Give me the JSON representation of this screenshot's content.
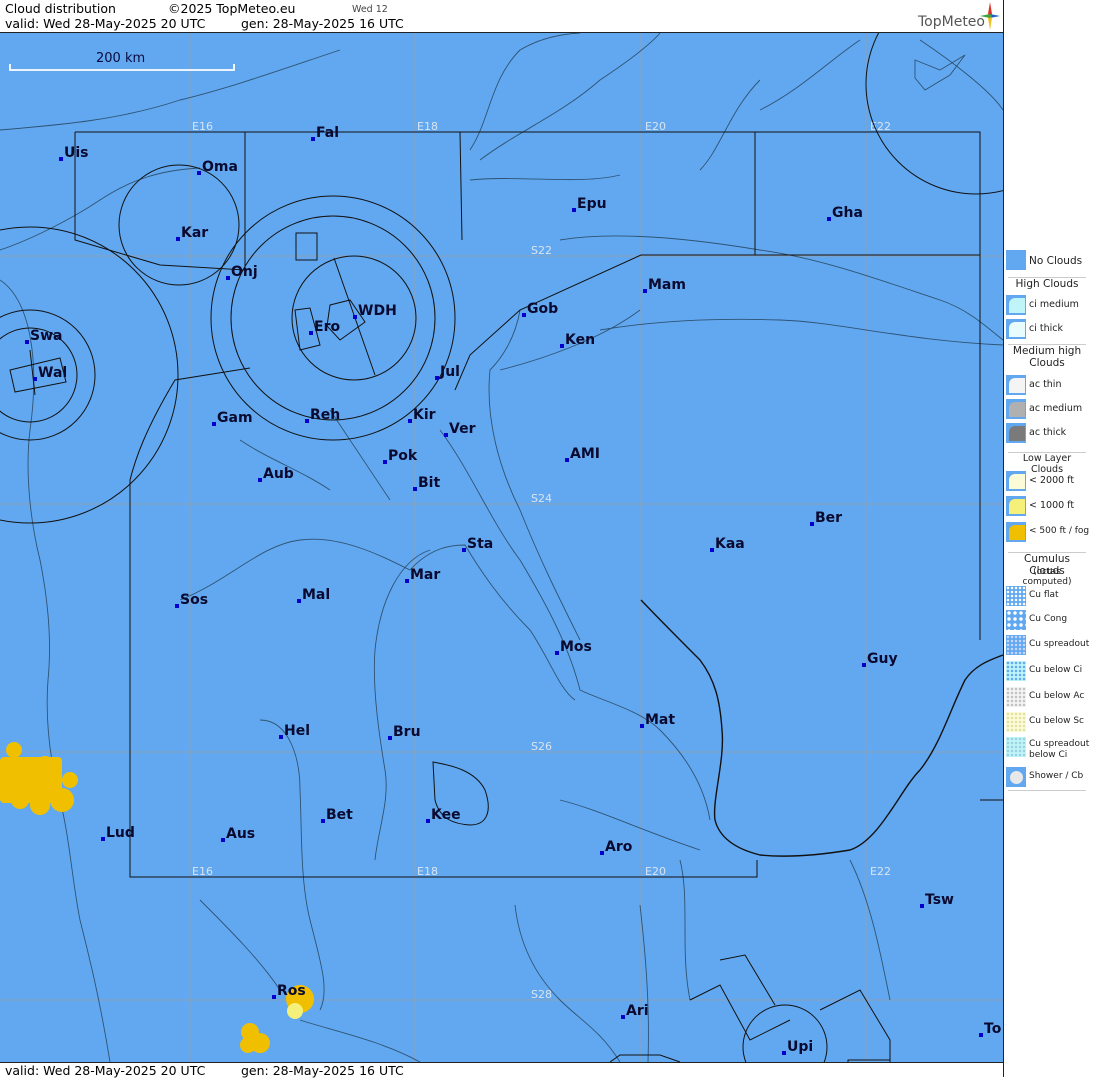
{
  "header": {
    "title": "Cloud distribution",
    "copyright": "©2025 TopMeteo.eu",
    "run_label": "Wed 12",
    "valid": "valid:  Wed  28-May-2025  20 UTC",
    "gen": "gen: 28-May-2025 16 UTC",
    "logo": "TopMeteo"
  },
  "footer": {
    "valid": "valid:  Wed  28-May-2025  20 UTC",
    "gen": "gen: 28-May-2025 16 UTC"
  },
  "scale": {
    "label": "200 km"
  },
  "colors": {
    "no_clouds": "#62a8f0",
    "low_500": "#f0c000",
    "low_1000": "#f4f07a",
    "border": "#000000",
    "river": "#26445e",
    "grid": "#8c9fb4",
    "city_dot": "#0000cc"
  },
  "grid_labels": {
    "lon": [
      "E16",
      "E18",
      "E20",
      "E22"
    ],
    "lat": [
      "S22",
      "S24",
      "S26",
      "S28"
    ]
  },
  "cities": [
    "Uis",
    "Fal",
    "Oma",
    "Kar",
    "Epu",
    "Gha",
    "Onj",
    "Mam",
    "Swa",
    "WDH",
    "Gob",
    "Ero",
    "Ken",
    "Wal",
    "Jul",
    "Gam",
    "Reh",
    "Kir",
    "Ver",
    "Pok",
    "AMI",
    "Aub",
    "Bit",
    "Ber",
    "Sta",
    "Kaa",
    "Mar",
    "Sos",
    "Mal",
    "Mos",
    "Guy",
    "Mat",
    "Hel",
    "Bru",
    "Kee",
    "Bet",
    "Lud",
    "Aus",
    "Aro",
    "Tsw",
    "Ros",
    "Ari",
    "To",
    "Upi"
  ],
  "legend": {
    "no_clouds": "No Clouds",
    "high_clouds": "High Clouds",
    "ci_medium": "ci medium",
    "ci_thick": "ci thick",
    "medium_high": "Medium high Clouds",
    "ac_thin": "ac thin",
    "ac_medium": "ac medium",
    "ac_thick": "ac thick",
    "low_layer": "Low Layer Clouds",
    "low_2000": "< 2000 ft",
    "low_1000": "< 1000 ft",
    "low_500": "< 500 ft / fog",
    "cumulus": "Cumulus Clouds",
    "cumulus_sub": "(octas computed)",
    "cu_flat": "Cu flat",
    "cu_cong": "Cu Cong",
    "cu_spreadout": "Cu spreadout",
    "cu_below_ci": "Cu below Ci",
    "cu_below_ac": "Cu below Ac",
    "cu_below_sc": "Cu below Sc",
    "cu_spreadout_below_ci": "Cu spreadout below Ci",
    "shower_cb": "Shower / Cb"
  }
}
